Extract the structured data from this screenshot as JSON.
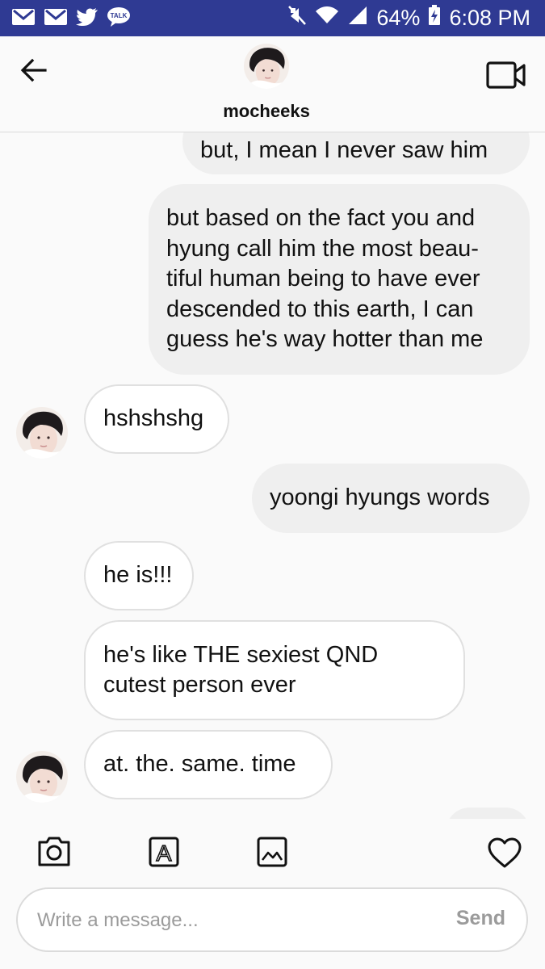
{
  "status_bar": {
    "battery": "64%",
    "time": "6:08 PM",
    "talk_label": "TALK",
    "icons": [
      "gmail-icon",
      "gmail-icon",
      "twitter-icon",
      "kakaotalk-icon",
      "mute-icon",
      "wifi-icon",
      "signal-icon",
      "battery-charging-icon"
    ]
  },
  "header": {
    "username": "mocheeks",
    "back_icon": "arrow-left-icon",
    "video_icon": "video-camera-icon"
  },
  "messages": [
    {
      "side": "outgoing",
      "lines": [
        "but, I mean I never saw him"
      ]
    },
    {
      "side": "outgoing",
      "lines": [
        "but based on the fact you and",
        "hyung call him the most beau-",
        "tiful human being to have ever",
        "descended to this earth, I can",
        "guess he's way hotter than me"
      ]
    },
    {
      "side": "incoming",
      "lines": [
        "hshshshg"
      ]
    },
    {
      "side": "outgoing",
      "lines": [
        "yoongi hyungs words"
      ]
    },
    {
      "side": "incoming",
      "lines": [
        "he is!!!"
      ]
    },
    {
      "side": "incoming",
      "lines": [
        "he's like THE sexiest QND",
        "cutest person ever"
      ]
    },
    {
      "side": "incoming",
      "lines": [
        "at. the. same. time"
      ]
    }
  ],
  "toolbar": {
    "icons": [
      "camera-icon",
      "sticker-icon",
      "gallery-icon",
      "heart-icon"
    ],
    "sticker_letter": "A"
  },
  "composer": {
    "placeholder": "Write a message...",
    "send_label": "Send"
  },
  "colors": {
    "status_bar": "#2f3a93",
    "outgoing_bubble": "#efefef",
    "incoming_bubble": "#ffffff",
    "incoming_border": "#e0e0e0",
    "background": "#fafafa"
  }
}
